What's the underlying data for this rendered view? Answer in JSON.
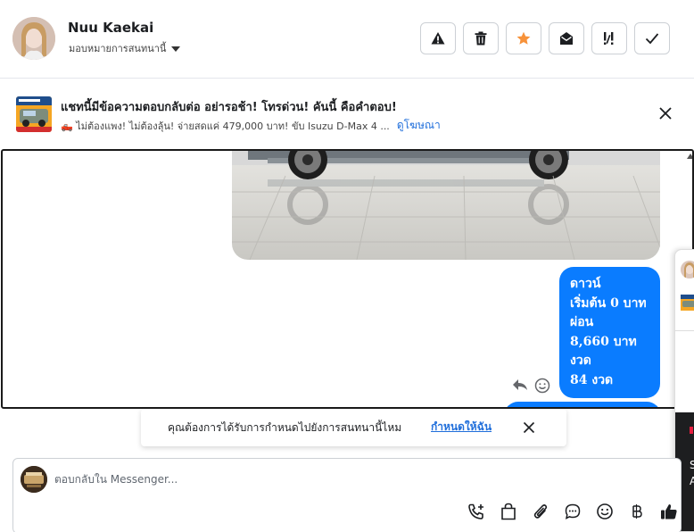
{
  "header": {
    "contact_name": "Nuu Kaekai",
    "assign_label": "มอบหมายการสนทนานี้",
    "actions": [
      {
        "icon": "warning-icon",
        "color": "#1c1e21"
      },
      {
        "icon": "trash-icon",
        "color": "#1c1e21"
      },
      {
        "icon": "star-icon",
        "color": "#f7923a"
      },
      {
        "icon": "envelope-open-icon",
        "color": "#1c1e21"
      },
      {
        "icon": "follow-up-icon",
        "color": "#1c1e21"
      },
      {
        "icon": "check-icon",
        "color": "#1c1e21"
      }
    ]
  },
  "ad": {
    "title": "แชทนี้มีข้อความตอบกลับต่อ อย่ารอช้า! โทรด่วน! คันนี้ คือคำตอบ!",
    "description": "🛻 ไม่ต้องแพง! ไม่ต้องลุ้น! จ่ายสดแค่ 479,000 บาท! ขับ Isuzu D-Max 4 ...",
    "link_label": "ดูโฆษณา"
  },
  "chat": {
    "message_lines": [
      "ดาวน์",
      "เริ่มต้น 0 บาท",
      "ผ่อน",
      "8,660 บาท",
      "งวด",
      "84 งวด"
    ],
    "bubble_color": "#0a7cff"
  },
  "toast": {
    "text": "คุณต้องการได้รับการกำหนดไปยังการสนทนานี้ไหม",
    "link_label": "กำหนดให้ฉัน"
  },
  "composer": {
    "placeholder": "ตอบกลับใน Messenger...",
    "tools": [
      "add-call-icon",
      "shopping-bag-icon",
      "paperclip-icon",
      "chat-bubble-icon",
      "emoji-icon",
      "baht-icon",
      "thumbs-up-icon"
    ]
  },
  "side_panel": {
    "text_1": "S",
    "text_2": "A"
  },
  "colors": {
    "accent": "#216fdb",
    "star": "#f7923a",
    "messenger_blue": "#0a7cff"
  }
}
